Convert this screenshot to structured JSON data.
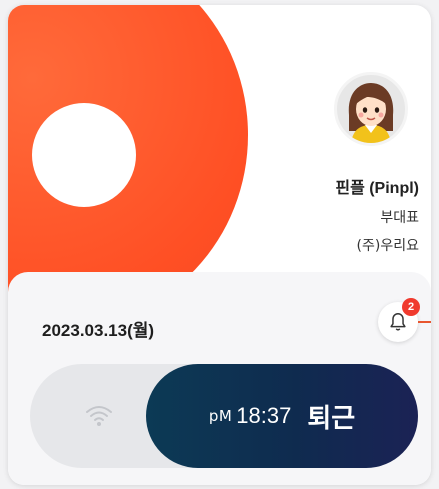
{
  "profile": {
    "name": "핀플 (Pinpl)",
    "title": "부대표",
    "company": "(주)우리요"
  },
  "attendance": {
    "date": "2023.03.13(월)",
    "notification_count": "2",
    "ampm": "pM",
    "time": "18:37",
    "action_label": "퇴근"
  },
  "colors": {
    "brand_orange": "#ff5a2c",
    "button_navy": "#0f2b4f",
    "badge_red": "#f03a2e"
  },
  "icons": [
    "avatar",
    "bell-icon",
    "wifi-icon"
  ]
}
